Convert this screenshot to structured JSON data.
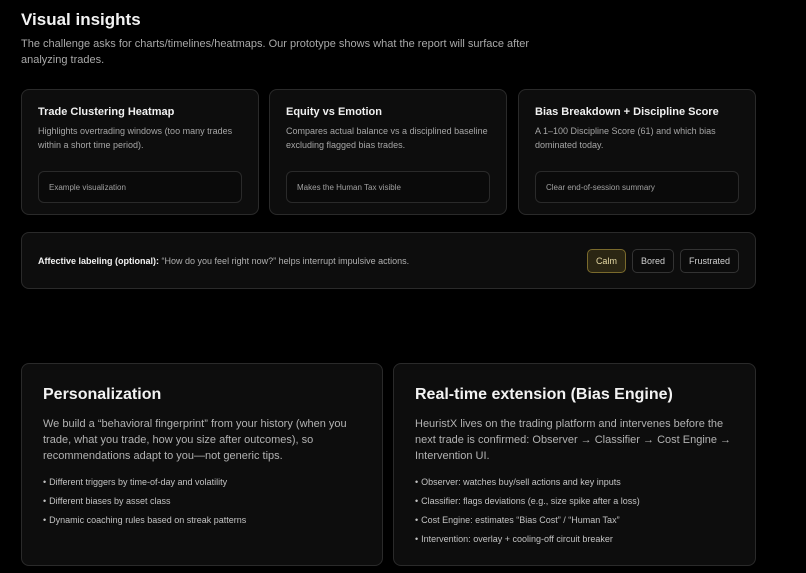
{
  "header": {
    "title": "Visual insights",
    "subtitle": "The challenge asks for charts/timelines/heatmaps. Our prototype shows what the report will surface after analyzing trades."
  },
  "viz_cards": [
    {
      "title": "Trade Clustering Heatmap",
      "description": "Highlights overtrading windows (too many trades within a short time period).",
      "inner_label": "Example visualization"
    },
    {
      "title": "Equity vs Emotion",
      "description": "Compares actual balance vs a disciplined baseline excluding flagged bias trades.",
      "inner_label": "Makes the Human Tax visible"
    },
    {
      "title": "Bias Breakdown + Discipline Score",
      "description": "A 1–100 Discipline Score (61) and which bias dominated today.",
      "inner_label": "Clear end-of-session summary"
    }
  ],
  "affect": {
    "label": "Affective labeling (optional):",
    "text": "“How do you feel right now?” helps interrupt impulsive actions.",
    "options": [
      "Calm",
      "Bored",
      "Frustrated"
    ],
    "selected": "Calm"
  },
  "personalization": {
    "title": "Personalization",
    "description": "We build a “behavioral fingerprint” from your history (when you trade, what you trade, how you size after outcomes), so recommendations adapt to you—not generic tips.",
    "bullets": [
      "Different triggers by time-of-day and volatility",
      "Different biases by asset class",
      "Dynamic coaching rules based on streak patterns"
    ]
  },
  "realtime": {
    "title": "Real-time extension (Bias Engine)",
    "description": "HeuristX lives on the trading platform and intervenes before the next trade is confirmed: Observer → Classifier → Cost Engine → Intervention UI.",
    "bullets": [
      "Observer: watches buy/sell actions and key inputs",
      "Classifier: flags deviations (e.g., size spike after a loss)",
      "Cost Engine: estimates “Bias Cost” / “Human Tax”",
      "Intervention: overlay + cooling-off circuit breaker"
    ]
  },
  "colors": {
    "background": "#000000",
    "card": "#0d0d0d",
    "border": "#2a2a2a",
    "chip_active": "#2b2613"
  }
}
